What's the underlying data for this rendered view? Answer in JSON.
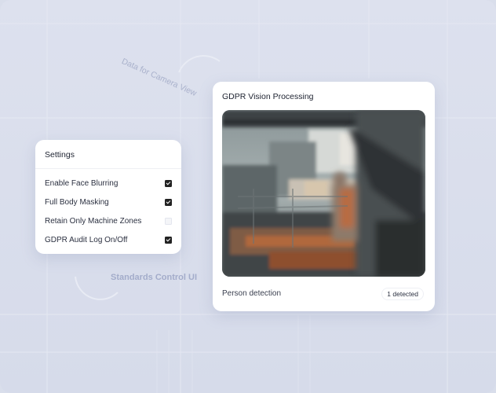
{
  "background": {
    "camera_view_label": "Data for Camera View",
    "standards_label": "Standards Control UI"
  },
  "settings": {
    "title": "Settings",
    "items": [
      {
        "label": "Enable Face Blurring",
        "checked": true
      },
      {
        "label": "Full Body Masking",
        "checked": true
      },
      {
        "label": "Retain Only Machine Zones",
        "checked": false
      },
      {
        "label": "GDPR Audit Log On/Off",
        "checked": true
      }
    ]
  },
  "vision": {
    "title": "GDPR Vision Processing",
    "detection_label": "Person detection",
    "detection_badge": "1 detected"
  },
  "colors": {
    "background": "#d9deeb",
    "card": "#ffffff",
    "checkbox_on": "#222222",
    "checkbox_off": "#f4f5f8"
  }
}
